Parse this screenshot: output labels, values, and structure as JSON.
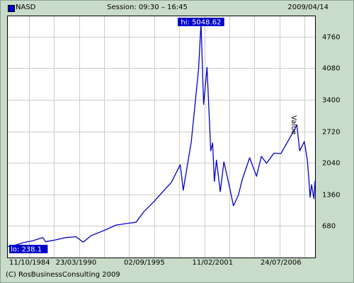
{
  "header": {
    "symbol": "NASD",
    "session": "Session: 09:30 – 16:45",
    "date": "2009/04/14"
  },
  "footer": {
    "copyright": "(C) RosBusinessConsulting 2009"
  },
  "colors": {
    "series": "#0000cc",
    "background": "#c9dbc9",
    "plot": "#ffffff",
    "grid": "#cccccc"
  },
  "chart_data": {
    "type": "line",
    "title": "",
    "ylabel": "Value",
    "ylim": [
      0,
      5200
    ],
    "yticks": [
      680,
      1360,
      2040,
      2720,
      3400,
      4080,
      4760
    ],
    "xticks": [
      "11/10/1984",
      "23/03/1990",
      "02/09/1995",
      "11/02/2001",
      "24/07/2006"
    ],
    "xlim": [
      "1984-10-11",
      "2009-04-14"
    ],
    "grid": true,
    "annotations": {
      "hi": "hi: 5048.62",
      "lo": "lo: 238.1"
    },
    "series": [
      {
        "name": "NASD",
        "x": [
          "1984-10-11",
          "1985-06-01",
          "1986-01-01",
          "1986-10-01",
          "1987-08-01",
          "1987-10-20",
          "1988-06-01",
          "1989-06-01",
          "1990-03-23",
          "1990-10-15",
          "1991-06-01",
          "1992-06-01",
          "1993-06-01",
          "1994-06-01",
          "1995-01-01",
          "1995-09-02",
          "1996-06-01",
          "1997-06-01",
          "1997-10-27",
          "1998-07-15",
          "1998-10-08",
          "1999-06-01",
          "1999-12-31",
          "2000-03-10",
          "2000-05-25",
          "2000-09-01",
          "2000-12-20",
          "2001-02-11",
          "2001-04-04",
          "2001-06-01",
          "2001-09-21",
          "2002-01-04",
          "2002-05-01",
          "2002-10-09",
          "2003-03-01",
          "2003-07-01",
          "2004-01-26",
          "2004-08-12",
          "2005-01-01",
          "2005-06-01",
          "2006-01-01",
          "2006-07-24",
          "2007-01-01",
          "2007-07-15",
          "2007-10-31",
          "2008-01-22",
          "2008-06-05",
          "2008-09-01",
          "2008-10-15",
          "2008-11-20",
          "2009-01-02",
          "2009-03-09",
          "2009-04-14"
        ],
        "y": [
          238.1,
          270,
          320,
          360,
          430,
          340,
          370,
          430,
          450,
          330,
          470,
          580,
          700,
          740,
          760,
          1000,
          1200,
          1500,
          1620,
          2000,
          1450,
          2500,
          4069,
          5048.62,
          3300,
          4100,
          2300,
          2470,
          1640,
          2100,
          1420,
          2060,
          1690,
          1114,
          1340,
          1700,
          2150,
          1750,
          2180,
          2030,
          2250,
          2240,
          2450,
          2700,
          2860,
          2300,
          2500,
          2100,
          1700,
          1300,
          1570,
          1268,
          1653
        ]
      }
    ]
  }
}
